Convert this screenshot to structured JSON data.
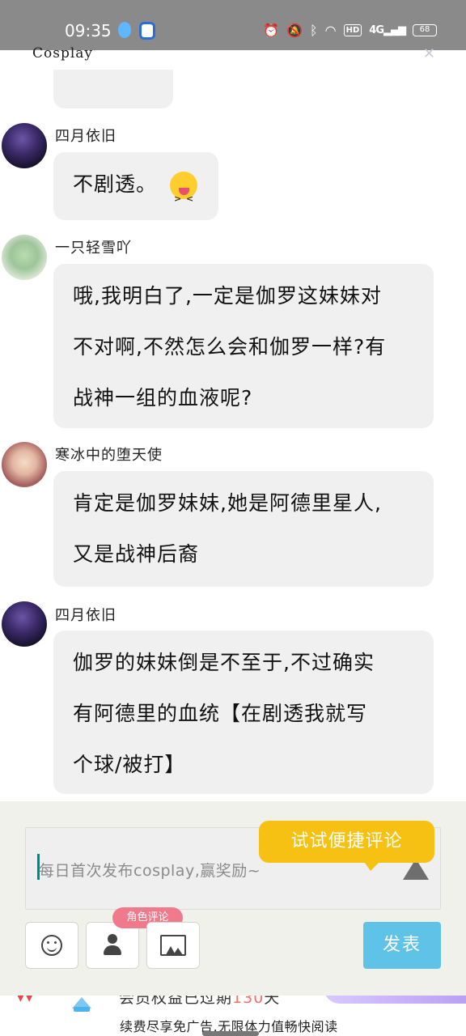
{
  "status_bar": {
    "time": "09:35",
    "battery": "68",
    "network": "4G",
    "hd": "HD"
  },
  "header": {
    "title": "Cosplay",
    "close_icon": "close-icon"
  },
  "comments": [
    {
      "user": "四月依旧",
      "text": "不剧透。",
      "emoji": "squinting-tongue-emoji"
    },
    {
      "user": "一只轻雪吖",
      "text": "哦,我明白了,一定是伽罗这妹妹对不对啊,不然怎么会和伽罗一样?有战神一组的血液呢?"
    },
    {
      "user": "寒冰中的堕天使",
      "text": "肯定是伽罗妹妹,她是阿德里星人,又是战神后裔"
    },
    {
      "user": "四月依旧",
      "text": "伽罗的妹妹倒是不至于,不过确实有阿德里的血统【在剧透我就写个球/被打】"
    }
  ],
  "comment_lines": {
    "c2": [
      "哦,我明白了,一定是伽罗这妹妹对",
      "不对啊,不然怎么会和伽罗一样?有",
      "战神一组的血液呢?"
    ],
    "c3": [
      "肯定是伽罗妹妹,她是阿德里星人,",
      "又是战神后裔"
    ],
    "c4": [
      "伽罗的妹妹倒是不至于,不过确实",
      "有阿德里的血统【在剧透我就写",
      "个球/被打】"
    ]
  },
  "composer": {
    "placeholder": "每日首次发布cosplay,赢奖励~",
    "tip": "试试便捷评论",
    "role_badge": "角色评论",
    "send_label": "发表",
    "tools": [
      "emoji-icon",
      "person-icon",
      "image-icon"
    ]
  },
  "footer_ad": {
    "line1_prefix": "会员权益已过期",
    "line1_days": "130",
    "line1_suffix": "天",
    "line2": "续费尽享免广告,无限体力值畅快阅读"
  },
  "colors": {
    "status_bar": "#8a8a8a",
    "bubble": "#f0f0f0",
    "tip": "#f7c114",
    "role_badge": "#f07a8c",
    "send_button": "#5fc3e8",
    "panel": "#f1f1ec"
  }
}
